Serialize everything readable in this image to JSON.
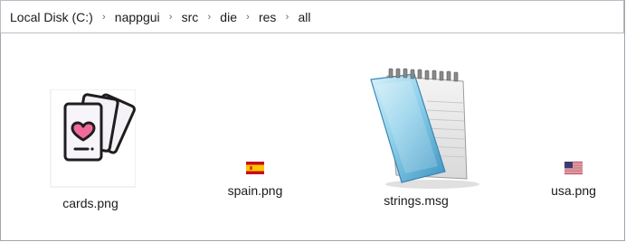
{
  "breadcrumb": [
    "Local Disk (C:)",
    "nappgui",
    "src",
    "die",
    "res",
    "all"
  ],
  "files": [
    {
      "name": "cards.png",
      "icon": "cards-icon"
    },
    {
      "name": "spain.png",
      "icon": "spain-flag-icon"
    },
    {
      "name": "strings.msg",
      "icon": "notepad-icon"
    },
    {
      "name": "usa.png",
      "icon": "usa-flag-icon"
    }
  ],
  "colors": {
    "spain_red": "#c60b1e",
    "spain_yellow": "#ffc400",
    "usa_red": "#b22234",
    "usa_blue": "#3c3b6e",
    "notepad_blue": "#5fb3d6"
  }
}
